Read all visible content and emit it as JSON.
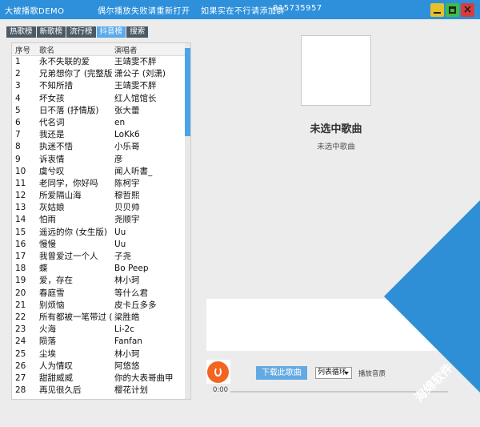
{
  "window": {
    "app_title": "大被播歌DEMO",
    "notice": "偶尔播放失败请重新打开",
    "group_text": "如果实在不行请添加群",
    "group_number": "815735957",
    "minimize_icon": "minimize-icon",
    "maximize_icon": "maximize-icon",
    "close_label": "×"
  },
  "tabs": [
    {
      "label": "热歌榜",
      "active": false
    },
    {
      "label": "新歌榜",
      "active": false
    },
    {
      "label": "流行榜",
      "active": false
    },
    {
      "label": "抖音榜",
      "active": true
    },
    {
      "label": "搜索",
      "active": false
    }
  ],
  "song_list": {
    "columns": [
      "序号",
      "歌名",
      "演唱者"
    ],
    "rows": [
      [
        "1",
        "永不失联的爱",
        "王靖雯不胖"
      ],
      [
        "2",
        "兄弟想你了 (完整版...",
        "潇公子 (刘潇)"
      ],
      [
        "3",
        "不知所措",
        "王靖雯不胖"
      ],
      [
        "4",
        "坏女孩",
        "红人馆馆长"
      ],
      [
        "5",
        "日不落 (抒情版)",
        "张大蕾"
      ],
      [
        "6",
        "代名词",
        "en"
      ],
      [
        "7",
        "我还是",
        "LoKk6"
      ],
      [
        "8",
        "执迷不悟",
        "小乐哥"
      ],
      [
        "9",
        "诉衷情",
        "彦"
      ],
      [
        "10",
        "虞兮叹",
        "闻人听書_"
      ],
      [
        "11",
        "老同学，你好吗",
        "陈柯宇"
      ],
      [
        "12",
        "所爱隔山海",
        "穆哲熙"
      ],
      [
        "13",
        "灰姑娘",
        "贝贝帅"
      ],
      [
        "14",
        "怕雨",
        "尧顺宇"
      ],
      [
        "15",
        "遥远的你 (女生版)",
        "Uu"
      ],
      [
        "16",
        "慢慢",
        "Uu"
      ],
      [
        "17",
        "我曾爱过一个人",
        "子尧"
      ],
      [
        "18",
        "蝶",
        "Bo Peep"
      ],
      [
        "19",
        "爱，存在",
        "林小珂"
      ],
      [
        "20",
        "春庭雪",
        "等什么君"
      ],
      [
        "21",
        "别烦恼",
        "皮卡丘多多"
      ],
      [
        "22",
        "所有都被一笔带过 (...",
        "梁胜皓"
      ],
      [
        "23",
        "火海",
        "Li-2c"
      ],
      [
        "24",
        "陨落",
        "Fanfan"
      ],
      [
        "25",
        "尘埃",
        "林小珂"
      ],
      [
        "26",
        "人为情叹",
        "阿悠悠"
      ],
      [
        "27",
        "甜甜威威",
        "你的大表哥曲甲"
      ],
      [
        "28",
        "再见很久后",
        "樱花计划"
      ]
    ]
  },
  "now_playing": {
    "title": "未选中歌曲",
    "artist": "未选中歌曲"
  },
  "controls": {
    "download_label": "下载此歌曲",
    "mode_value": "列表循环",
    "quality_label": "播放音质",
    "time": "0:00",
    "progress": 0.0
  },
  "watermark": {
    "text": "海绵软件"
  },
  "colors": {
    "titlebar": "#2e90db",
    "tab_active": "#5aa9ea",
    "play_button": "#f26522"
  }
}
